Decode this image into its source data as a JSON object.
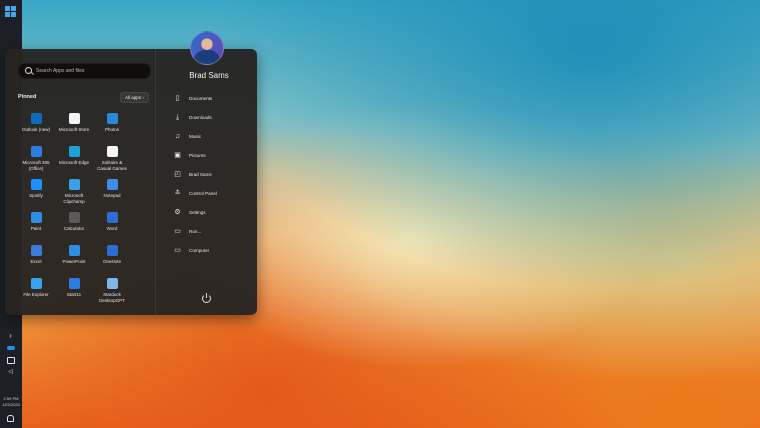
{
  "taskbar": {
    "start_icon": "windows-logo-icon",
    "tray_icons": [
      "chevron-right-icon",
      "onedrive-icon",
      "network-icon",
      "speaker-icon",
      "notification-bell-icon"
    ],
    "time": "2:59 PM",
    "date": "12/2/2024"
  },
  "start_menu": {
    "search_placeholder": "Search Apps and files",
    "pinned_label": "Pinned",
    "all_apps_label": "All apps",
    "all_apps_chevron": "›",
    "apps": [
      {
        "label": "Outlook (new)",
        "icon": "outlook-icon",
        "color": "#0f6cbd"
      },
      {
        "label": "Microsoft Store",
        "icon": "store-icon",
        "color": "#f3f3f3"
      },
      {
        "label": "Photos",
        "icon": "photos-icon",
        "color": "#2b88d8"
      },
      {
        "label": "Microsoft 365\n(Office)",
        "icon": "office-icon",
        "color": "#2c7de0"
      },
      {
        "label": "Microsoft Edge",
        "icon": "edge-icon",
        "color": "#1ea1d6"
      },
      {
        "label": "Solitaire &\nCasual Games",
        "icon": "solitaire-icon",
        "color": "#f5f5f5"
      },
      {
        "label": "Spotify",
        "icon": "spotify-icon",
        "color": "#1e90ff"
      },
      {
        "label": "Microsoft\nClipchamp",
        "icon": "clipchamp-icon",
        "color": "#3aa0e8"
      },
      {
        "label": "Notepad",
        "icon": "notepad-icon",
        "color": "#3b8ee8"
      },
      {
        "label": "Paint",
        "icon": "paint-icon",
        "color": "#2f8de4"
      },
      {
        "label": "Calculator",
        "icon": "calculator-icon",
        "color": "#5a5a5a"
      },
      {
        "label": "Word",
        "icon": "word-icon",
        "color": "#2b6fd6"
      },
      {
        "label": "Excel",
        "icon": "excel-icon",
        "color": "#3a7bd5"
      },
      {
        "label": "PowerPoint",
        "icon": "powerpoint-icon",
        "color": "#2d8fe0"
      },
      {
        "label": "OneNote",
        "icon": "onenote-icon",
        "color": "#2b6fd6"
      },
      {
        "label": "File Explorer",
        "icon": "folder-icon",
        "color": "#3aa3f0"
      },
      {
        "label": "Start11",
        "icon": "start11-icon",
        "color": "#2c7de0"
      },
      {
        "label": "Stardock\nDesktopGPT",
        "icon": "desktopgpt-icon",
        "color": "#7fb4e6"
      }
    ],
    "user": {
      "name": "Brad Sams",
      "avatar_icon": "user-avatar"
    },
    "right_items": [
      {
        "label": "Documents",
        "icon": "document-icon",
        "glyph": "▯"
      },
      {
        "label": "Downloads",
        "icon": "download-icon",
        "glyph": "⤓"
      },
      {
        "label": "Music",
        "icon": "music-icon",
        "glyph": "♫"
      },
      {
        "label": "Pictures",
        "icon": "pictures-icon",
        "glyph": "▣"
      },
      {
        "label": "Brad Sams",
        "icon": "user-folder-icon",
        "glyph": "◰"
      },
      {
        "label": "Control Panel",
        "icon": "control-panel-icon",
        "glyph": "≛"
      },
      {
        "label": "Settings",
        "icon": "settings-icon",
        "glyph": "⚙"
      },
      {
        "label": "Run...",
        "icon": "run-icon",
        "glyph": "▭"
      },
      {
        "label": "Computer",
        "icon": "computer-icon",
        "glyph": "▭"
      }
    ],
    "power_icon": "power-icon"
  }
}
